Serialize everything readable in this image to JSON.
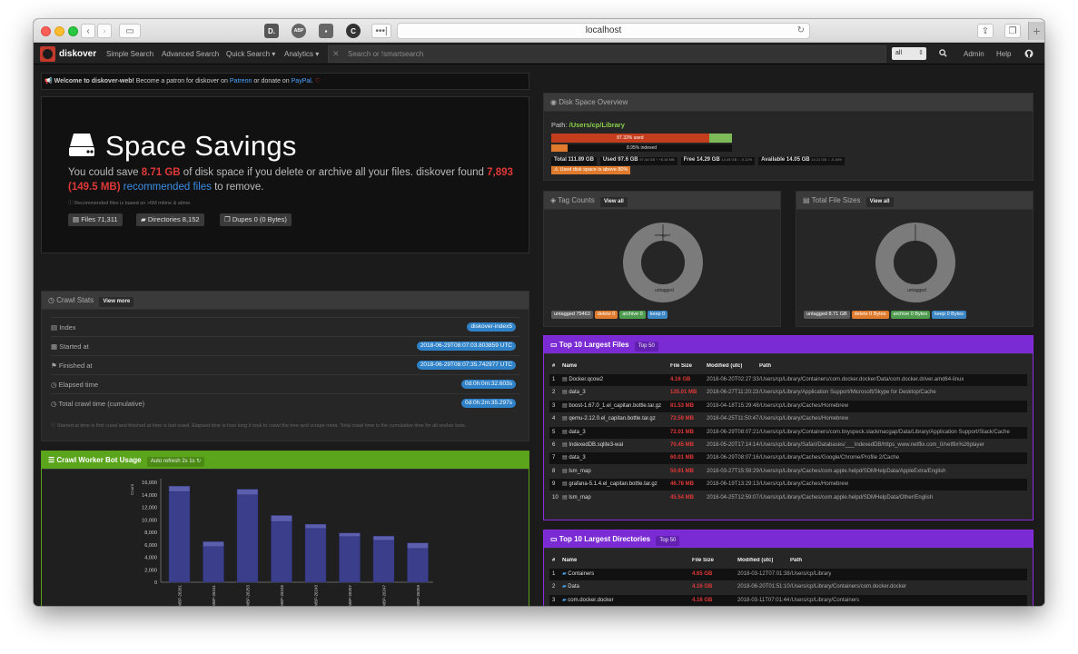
{
  "browser": {
    "url": "localhost"
  },
  "navbar": {
    "brand": "diskover",
    "links": [
      "Simple Search",
      "Advanced Search",
      "Quick Search ▾",
      "Analytics ▾"
    ],
    "search_placeholder": "Search or !smartsearch",
    "select_value": "all",
    "right_links": [
      "Admin",
      "Help"
    ]
  },
  "welcome": {
    "prefix": "Welcome to diskover-web!",
    "middle": " Become a patron for diskover on ",
    "patreon": "Patreon",
    "or": " or donate on ",
    "paypal": "PayPal",
    "end": "."
  },
  "savings": {
    "title": "Space Savings",
    "l1_a": "You could save ",
    "l1_size": "8.71 GB",
    "l1_b": " of disk space if you delete or archive all your files. diskover found ",
    "l1_count": "7,893",
    "l2_open": "(",
    "l2_size": "149.5 MB",
    "l2_close": ") ",
    "l2_link": "recommended files",
    "l2_end": " to remove.",
    "note": "Recommended files is based on >6M mtime & atime.",
    "badges": [
      "Files 71,311",
      "Directories 8,152",
      "Dupes 0 (0 Bytes)"
    ]
  },
  "crawl": {
    "title": "Crawl Stats",
    "button": "View more",
    "rows": [
      {
        "label": "Index",
        "value": "diskover-index5"
      },
      {
        "label": "Started at",
        "value": "2018-06-29T08:07:03.803859 UTC"
      },
      {
        "label": "Finished at",
        "value": "2018-06-29T08:07:35.742977 UTC"
      },
      {
        "label": "Elapsed time",
        "value": "0d:0h:0m:32.603s"
      },
      {
        "label": "Total crawl time (cumulative)",
        "value": "0d:0h:2m:35.297s"
      }
    ],
    "note": "Started at time is first crawl and finished at time is last crawl. Elapsed time is how long it took to crawl the tree and scrape meta. Total crawl time is the cumulative time for all worker bots."
  },
  "worker": {
    "title": "Crawl Worker Bot Usage",
    "auto": "Auto refresh 2s 1s"
  },
  "chart_data": {
    "type": "bar",
    "ylabel": "Count",
    "ylim": [
      0,
      16000
    ],
    "yticks": [
      "16,000",
      "14,000",
      "12,000",
      "10,000",
      "8,000",
      "6,000",
      "4,000",
      "2,000",
      "0"
    ],
    "categories": [
      "Chriss-MBP-26261",
      "Chriss-MBP-26241",
      "Chriss-MBP-26253",
      "Chriss-MBP-26245",
      "Chriss-MBP-26243",
      "Chriss-MBP-26257",
      "Chriss-MBP-26247",
      "Chriss-MBP-26259"
    ],
    "series": [
      {
        "values": [
          14500,
          5700,
          14000,
          9700,
          8600,
          7300,
          6700,
          5400
        ]
      },
      {
        "values": [
          900,
          800,
          900,
          1000,
          700,
          600,
          700,
          900
        ]
      }
    ]
  },
  "disk": {
    "title": "Disk Space Overview",
    "path_label": "Path:",
    "path": "/Users/cp/Library",
    "bar1_text": "87.33% used",
    "bar1_pct": 0.8733,
    "bar2_text": "8.95% indexed",
    "bar2_pct": 0.0895,
    "stats": [
      {
        "label": "Total 111.89 GB",
        "extra": ""
      },
      {
        "label": "Used 97.6 GB",
        "extra": "97.44 GB ↑ +6.16 MB"
      },
      {
        "label": "Free 14.29 GB",
        "extra": "14.45 GB ↓ -0.12%"
      },
      {
        "label": "Available 14.05 GB",
        "extra": "14.21 GB ↓ -0.16%"
      }
    ],
    "warning": "Used disk space is above 80%"
  },
  "tags": {
    "title": "Tag Counts",
    "button": "View all",
    "ring_label": "untagged",
    "badges": [
      {
        "text": "untagged 79463",
        "color": "#5b5b5b"
      },
      {
        "text": "delete 0",
        "color": "#e07b2d"
      },
      {
        "text": "archive 0",
        "color": "#4e9a4e"
      },
      {
        "text": "keep 0",
        "color": "#3b86c4"
      }
    ]
  },
  "filesizes": {
    "title": "Total File Sizes",
    "button": "View all",
    "ring_label": "untagged",
    "badges": [
      {
        "text": "untagged 8.71 GB",
        "color": "#5b5b5b"
      },
      {
        "text": "delete 0 Bytes",
        "color": "#e07b2d"
      },
      {
        "text": "archive 0 Bytes",
        "color": "#4e9a4e"
      },
      {
        "text": "keep 0 Bytes",
        "color": "#3b86c4"
      }
    ]
  },
  "top_files": {
    "title": "Top 10 Largest Files",
    "button": "Top 50",
    "headers": [
      "#",
      "Name",
      "File Size",
      "Modified (utc)",
      "Path"
    ],
    "rows": [
      [
        "1",
        "Docker.qcow2",
        "4.16 GB",
        "2018-06-20T02:27:33",
        "/Users/cp/Library/Containers/com.docker.docker/Data/com.docker.driver.amd64-linux"
      ],
      [
        "2",
        "data_3",
        "135.01 MB",
        "2018-06-27T11:20:23",
        "/Users/cp/Library/Application Support/Microsoft/Skype for Desktop/Cache"
      ],
      [
        "3",
        "boost-1.67.0_1.el_capitan.bottle.tar.gz",
        "81.53 MB",
        "2018-04-18T15:29:48",
        "/Users/cp/Library/Caches/Homebrew"
      ],
      [
        "4",
        "qemu-2.12.0.el_capitan.bottle.tar.gz",
        "72.59 MB",
        "2018-04-25T11:50:47",
        "/Users/cp/Library/Caches/Homebrew"
      ],
      [
        "5",
        "data_3",
        "72.01 MB",
        "2018-06-29T08:07:21",
        "/Users/cp/Library/Containers/com.tinyspeck.slackmacgap/Data/Library/Application Support/Slack/Cache"
      ],
      [
        "6",
        "IndexedDB.sqlite3-wal",
        "70.45 MB",
        "2018-05-20T17:14:14",
        "/Users/cp/Library/Safari/Databases/___IndexedDB/https_www.netflix.com_0/netflix%26player"
      ],
      [
        "7",
        "data_3",
        "60.01 MB",
        "2018-06-29T08:07:16",
        "/Users/cp/Library/Caches/Google/Chrome/Profile 2/Cache"
      ],
      [
        "8",
        "lsm_map",
        "50.91 MB",
        "2018-03-27T15:59:29",
        "/Users/cp/Library/Caches/com.apple.helpd/SDMHelpData/AppleExtra/English"
      ],
      [
        "9",
        "grafana-5.1.4.el_capitan.bottle.tar.gz",
        "46.78 MB",
        "2018-06-19T13:29:13",
        "/Users/cp/Library/Caches/Homebrew"
      ],
      [
        "10",
        "lsm_map",
        "45.54 MB",
        "2018-04-25T12:59:07",
        "/Users/cp/Library/Caches/com.apple.helpd/SDMHelpData/Other/English"
      ]
    ]
  },
  "top_dirs": {
    "title": "Top 10 Largest Directories",
    "button": "Top 50",
    "headers": [
      "#",
      "Name",
      "File Size",
      "Modified (utc)",
      "Path"
    ],
    "rows": [
      [
        "1",
        "Containers",
        "4.65 GB",
        "2018-03-12T07:01:38",
        "/Users/cp/Library"
      ],
      [
        "2",
        "Data",
        "4.16 GB",
        "2018-06-20T01:51:10",
        "/Users/cp/Library/Containers/com.docker.docker"
      ],
      [
        "3",
        "com.docker.docker",
        "4.16 GB",
        "2018-03-11T07:01:44",
        "/Users/cp/Library/Containers"
      ],
      [
        "4",
        "com.docker.driver.amd64-linux",
        "4.16 GB",
        "2018-06-20T02:27:33",
        "/Users/cp/Library/Containers/com.docker.docker/Data"
      ]
    ]
  }
}
